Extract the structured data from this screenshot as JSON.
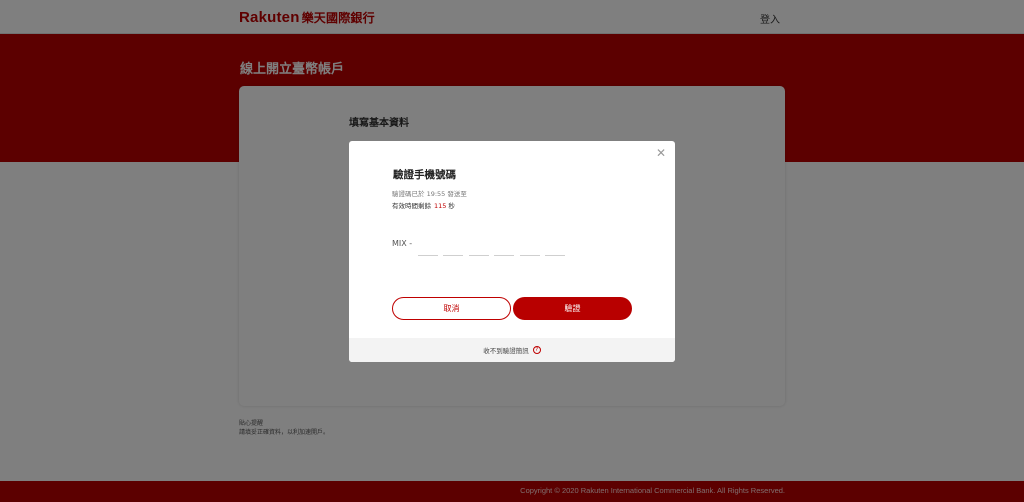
{
  "header": {
    "logo_text": "Rakuten",
    "logo_cn": "樂天國際銀行",
    "login_label": "登入"
  },
  "page": {
    "title": "線上開立臺幣帳戶",
    "section_title": "填寫基本資料",
    "notice_heading": "貼心提醒",
    "notice_text": "請填妥正確資料，以利加速開戶。"
  },
  "footer": {
    "copyright": "Copyright © 2020 Rakuten International Commercial Bank. All Rights Reserved."
  },
  "modal": {
    "title": "驗證手機號碼",
    "sent_line": "驗證碼已於 19:55 發送至",
    "valid_prefix": "有效時間剩餘",
    "valid_seconds": "115",
    "valid_unit": "秒",
    "code_prefix": "MIX -",
    "code_digits": [
      "",
      "",
      "",
      "",
      "",
      ""
    ],
    "cancel_label": "取消",
    "verify_label": "驗證",
    "not_received_label": "收不到驗證簡訊",
    "help_icon_glyph": "?"
  },
  "colors": {
    "brand_red": "#bf0000",
    "band_red": "#b80000",
    "overlay": "rgba(0,0,0,0.5)"
  },
  "icons": {
    "close": "close-icon",
    "help": "question-circle-icon"
  }
}
